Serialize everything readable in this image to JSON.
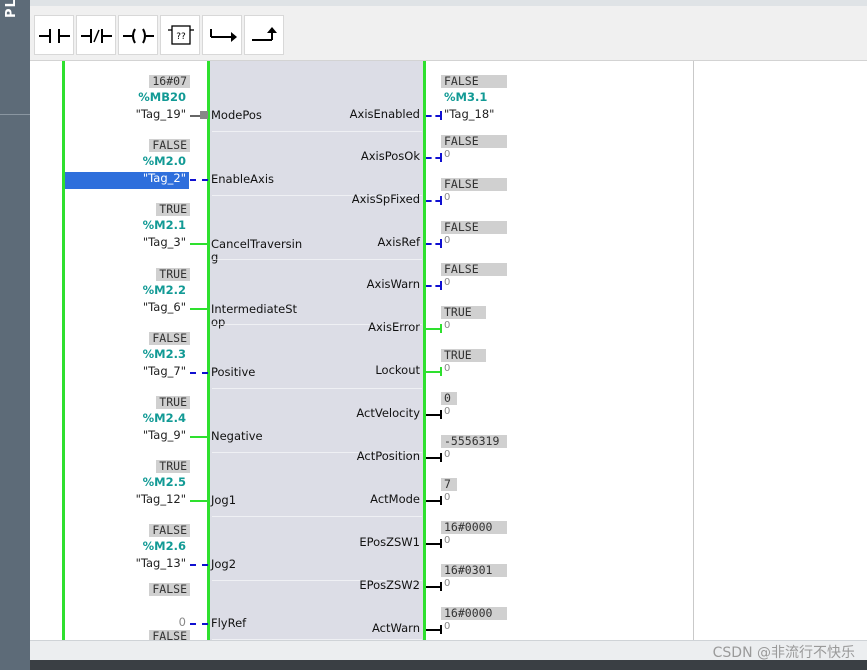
{
  "left_panel": {
    "label": "PL"
  },
  "toolbar": {
    "buttons": [
      {
        "name": "no-contact-button",
        "icon": "normally-open-contact-icon"
      },
      {
        "name": "nc-contact-button",
        "icon": "normally-closed-contact-icon"
      },
      {
        "name": "coil-button",
        "icon": "coil-icon"
      },
      {
        "name": "empty-box-button",
        "icon": "empty-box-icon",
        "glyph": "??"
      },
      {
        "name": "open-branch-button",
        "icon": "open-branch-icon"
      },
      {
        "name": "close-branch-button",
        "icon": "close-branch-icon"
      }
    ]
  },
  "inputs": [
    {
      "value": "16#07",
      "address": "%MB20",
      "tag": "\"Tag_19\"",
      "pin": "ModePos"
    },
    {
      "value": "FALSE",
      "address": "%M2.0",
      "tag": "\"Tag_2\"",
      "pin": "EnableAxis"
    },
    {
      "value": "TRUE",
      "address": "%M2.1",
      "tag": "\"Tag_3\"",
      "pin": "CancelTraversin",
      "pin2": "g"
    },
    {
      "value": "TRUE",
      "address": "%M2.2",
      "tag": "\"Tag_6\"",
      "pin": "IntermediateSt",
      "pin2": "op"
    },
    {
      "value": "FALSE",
      "address": "%M2.3",
      "tag": "\"Tag_7\"",
      "pin": "Positive"
    },
    {
      "value": "TRUE",
      "address": "%M2.4",
      "tag": "\"Tag_9\"",
      "pin": "Negative"
    },
    {
      "value": "TRUE",
      "address": "%M2.5",
      "tag": "\"Tag_12\"",
      "pin": "Jog1"
    },
    {
      "value": "FALSE",
      "address": "%M2.6",
      "tag": "\"Tag_13\"",
      "pin": "Jog2"
    },
    {
      "value": "FALSE",
      "address": "",
      "tag": "0",
      "pin": "FlyRef"
    },
    {
      "value": "FALSE"
    }
  ],
  "outputs": [
    {
      "value": "FALSE",
      "address": "%M3.1",
      "tag": "\"Tag_18\"",
      "pin": "AxisEnabled"
    },
    {
      "value": "FALSE",
      "tag": "0",
      "pin": "AxisPosOk"
    },
    {
      "value": "FALSE",
      "tag": "0",
      "pin": "AxisSpFixed"
    },
    {
      "value": "FALSE",
      "tag": "0",
      "pin": "AxisRef"
    },
    {
      "value": "FALSE",
      "tag": "0",
      "pin": "AxisWarn"
    },
    {
      "value": "TRUE",
      "tag": "0",
      "pin": "AxisError"
    },
    {
      "value": "TRUE",
      "tag": "0",
      "pin": "Lockout"
    },
    {
      "value": "0",
      "tag": "0",
      "pin": "ActVelocity"
    },
    {
      "value": "-5556319",
      "tag": "0",
      "pin": "ActPosition"
    },
    {
      "value": "7",
      "tag": "0",
      "pin": "ActMode"
    },
    {
      "value": "16#0000",
      "tag": "0",
      "pin": "EPosZSW1"
    },
    {
      "value": "16#0301",
      "tag": "0",
      "pin": "EPosZSW2"
    },
    {
      "value": "16#0000",
      "tag": "0",
      "pin": "ActWarn"
    }
  ],
  "watermark": "CSDN @非流行不快乐",
  "colors": {
    "rail": "#2ee02e",
    "block": "#dcdde6",
    "address": "#129a95",
    "selection": "#2e6fdc",
    "dashed_wire": "#1010d0"
  }
}
